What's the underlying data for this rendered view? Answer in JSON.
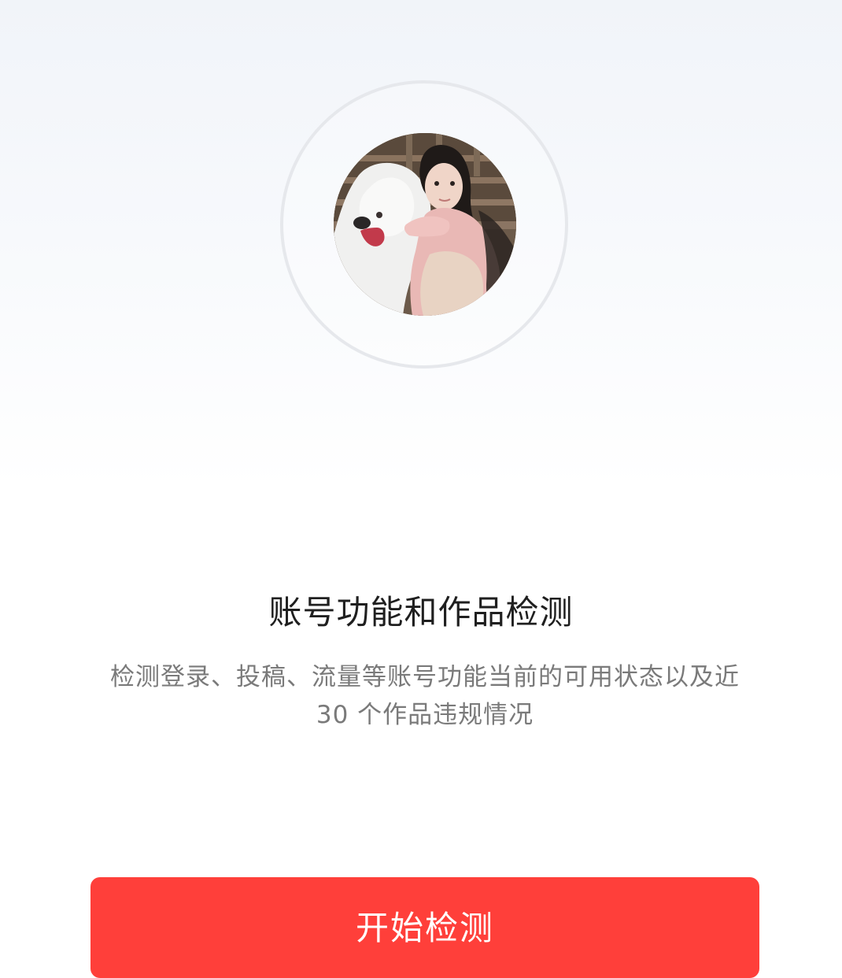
{
  "detection": {
    "title": "账号功能和作品检测",
    "description": "检测登录、投稿、流量等账号功能当前的可用状态以及近 30 个作品违规情况",
    "button_label": "开始检测"
  },
  "colors": {
    "button": "#ff3f3a",
    "ring": "#e6e8ec",
    "title_text": "#1f1f1f",
    "description_text": "#7a7a7a"
  }
}
